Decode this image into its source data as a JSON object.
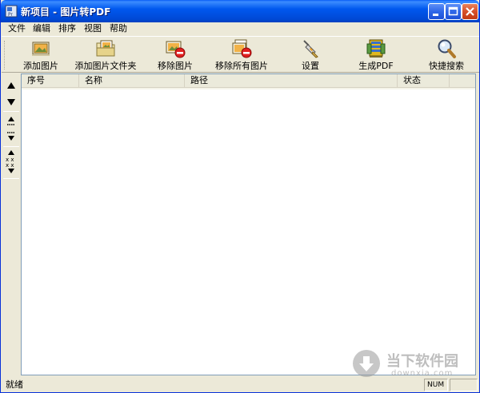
{
  "window": {
    "title": "新项目 - 图片转PDF"
  },
  "menu": {
    "items": [
      "文件",
      "编辑",
      "排序",
      "视图",
      "帮助"
    ]
  },
  "toolbar": {
    "buttons": [
      {
        "label": "添加图片",
        "icon": "add-image-icon"
      },
      {
        "label": "添加图片文件夹",
        "icon": "add-folder-icon"
      },
      {
        "label": "移除图片",
        "icon": "remove-image-icon"
      },
      {
        "label": "移除所有图片",
        "icon": "remove-all-icon"
      },
      {
        "label": "设置",
        "icon": "settings-icon"
      },
      {
        "label": "生成PDF",
        "icon": "generate-pdf-icon"
      },
      {
        "label": "快捷搜索",
        "icon": "search-icon"
      }
    ]
  },
  "sidebar": {
    "buttons": [
      "move-up-icon",
      "move-down-icon",
      "move-top-icon",
      "move-bottom-icon",
      "sort-icon"
    ]
  },
  "list": {
    "columns": [
      "序号",
      "名称",
      "路径",
      "状态"
    ]
  },
  "statusbar": {
    "text": "就绪",
    "num": "NUM"
  },
  "watermark": {
    "title": "当下软件园",
    "subtitle": "downxia.com"
  },
  "colors": {
    "titlebar": "#0058ee",
    "face": "#ece9d8",
    "border": "#7f9db9"
  }
}
